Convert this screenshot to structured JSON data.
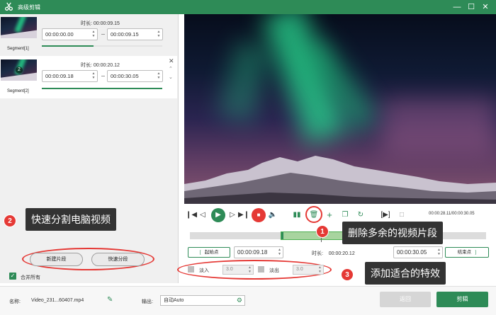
{
  "window": {
    "title": "高级剪辑",
    "logo_icon": "scissors-logo-icon",
    "controls": [
      "minimize-icon",
      "maximize-icon",
      "close-icon"
    ]
  },
  "colors": {
    "accent": "#2e8b57",
    "annotation_bg": "#333333",
    "badge": "#e53935"
  },
  "segments": [
    {
      "label": "Segment[1]",
      "duration_label": "时长:",
      "duration": "00:00:09.15",
      "start": "00:00:00.00",
      "end": "00:00:09.15",
      "progress": 0.43
    },
    {
      "label": "Segment[2]",
      "duration_label": "时长:",
      "duration": "00:00:20.12",
      "start": "00:00:09.18",
      "end": "00:00:30.05",
      "progress": 1.0,
      "thumb_badge": "2"
    }
  ],
  "annotations": [
    {
      "number": "1",
      "text": "删除多余的视频片段"
    },
    {
      "number": "2",
      "text": "快速分割电脑视频"
    },
    {
      "number": "3",
      "text": "添加适合的特效"
    }
  ],
  "left_buttons": {
    "new_segment": "新建片段",
    "quick_split": "快速分段"
  },
  "merge": {
    "label": "合并所有",
    "checked": true
  },
  "player": {
    "time_readout": "00:00:28.11/00:00:30.05",
    "buttons": [
      "start-icon",
      "prev-frame-icon",
      "play-icon",
      "next-frame-icon",
      "end-icon",
      "stop-icon",
      "volume-icon",
      "split-icon",
      "delete-icon",
      "add-icon",
      "copy-icon",
      "rotate-icon",
      "bracket-play-icon",
      "snapshot-icon"
    ]
  },
  "trim": {
    "start_btn": "起始点",
    "start_bracket": "[",
    "start_time": "00:00:09.18",
    "duration_label": "时长:",
    "duration": "00:00:20.12",
    "end_time": "00:00:30.05",
    "end_btn": "结束点",
    "end_bracket": "]"
  },
  "effects": {
    "fade_in_label": "淡入",
    "fade_in_value": "3.0",
    "fade_out_label": "淡出",
    "fade_out_value": "3.0"
  },
  "footer": {
    "name_label": "名称:",
    "name_value": "Video_231...60407.mp4",
    "output_label": "输出:",
    "output_value": "自动Auto",
    "back_button": "返回",
    "edit_button": "剪辑"
  }
}
